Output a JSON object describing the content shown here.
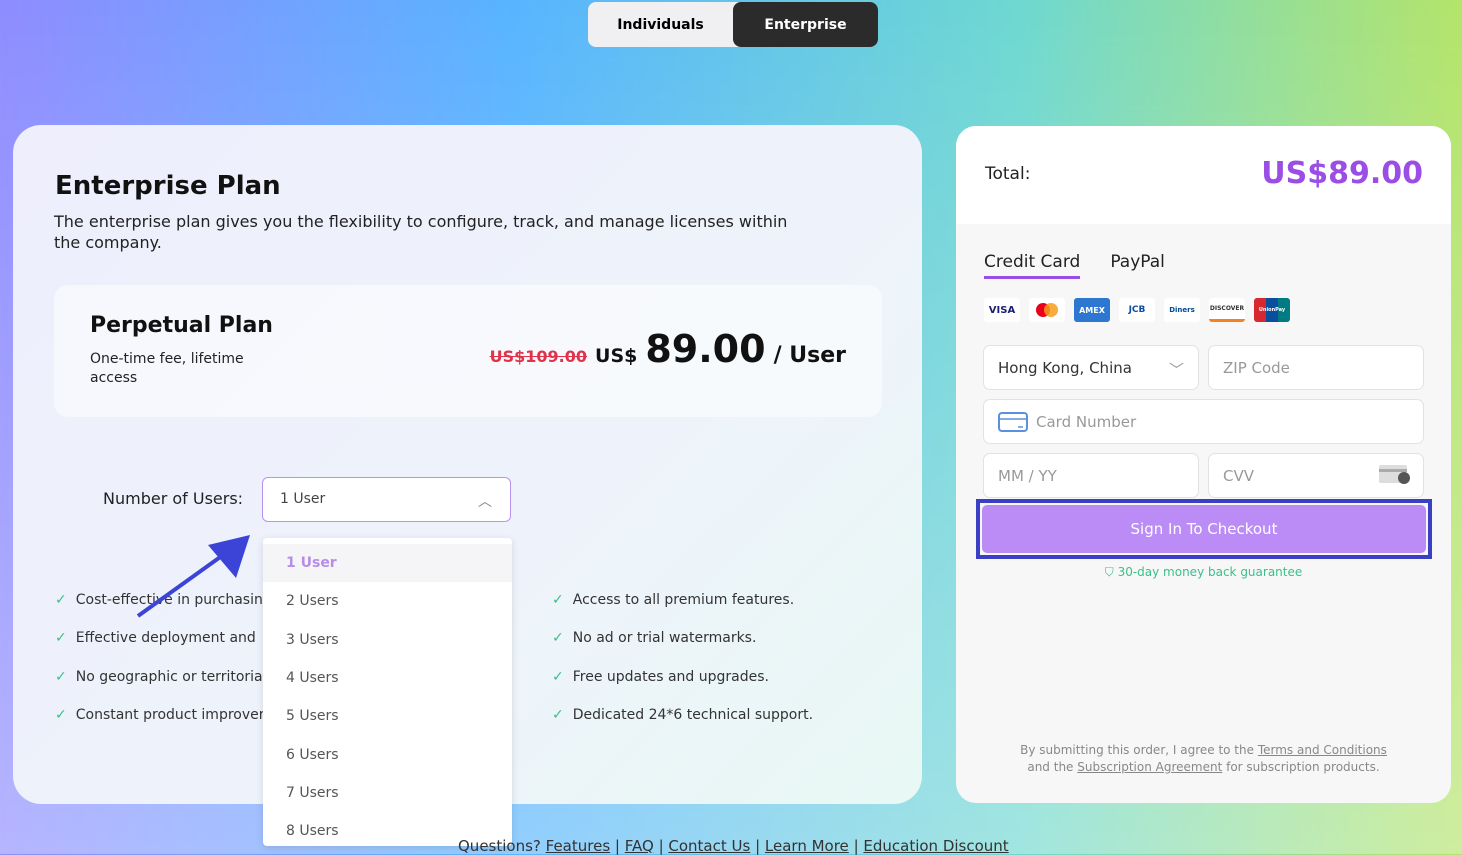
{
  "toggle": {
    "individuals": "Individuals",
    "enterprise": "Enterprise"
  },
  "plan": {
    "title": "Enterprise Plan",
    "description": "The enterprise plan gives you the flexibility to configure, track, and manage licenses within the company.",
    "card_title": "Perpetual Plan",
    "card_sub": "One-time fee, lifetime access",
    "old_price": "US$109.00",
    "currency": "US$",
    "amount": "89.00",
    "per": "/ User"
  },
  "users": {
    "label": "Number of Users:",
    "selected": "1 User",
    "options": [
      "1 User",
      "2 Users",
      "3 Users",
      "4 Users",
      "5 Users",
      "6 Users",
      "7 Users",
      "8 Users"
    ]
  },
  "features_left": [
    "Cost-effective in purchasin",
    "Effective deployment and",
    "No geographic or territoria",
    "Constant product improver"
  ],
  "features_right": [
    "Access to all premium features.",
    "No ad or trial watermarks.",
    "Free updates and upgrades.",
    "Dedicated 24*6 technical support."
  ],
  "checkout": {
    "total_label": "Total:",
    "total_value": "US$89.00",
    "tabs": [
      "Credit Card",
      "PayPal"
    ],
    "cards": [
      "VISA",
      "MC",
      "AMEX",
      "JCB",
      "Diners",
      "DISCOVER",
      "UnionPay"
    ],
    "country": "Hong Kong, China",
    "zip_placeholder": "ZIP Code",
    "card_placeholder": "Card Number",
    "exp_placeholder": "MM / YY",
    "cvv_placeholder": "CVV",
    "button": "Sign In To Checkout",
    "guarantee": "30-day money back guarantee",
    "terms_1": "By submitting this order, I agree to the ",
    "terms_link1": "Terms and Conditions",
    "terms_2": "and the ",
    "terms_link2": "Subscription Agreement",
    "terms_3": " for subscription products."
  },
  "footer": {
    "prefix": "Questions? ",
    "links": [
      "Features",
      "FAQ",
      "Contact Us",
      "Learn More",
      "Education Discount"
    ]
  },
  "colors": {
    "accent": "#9b4ee6",
    "button": "#bb8cf6",
    "check": "#3bbf8a",
    "highlight": "#3b3fc4"
  }
}
